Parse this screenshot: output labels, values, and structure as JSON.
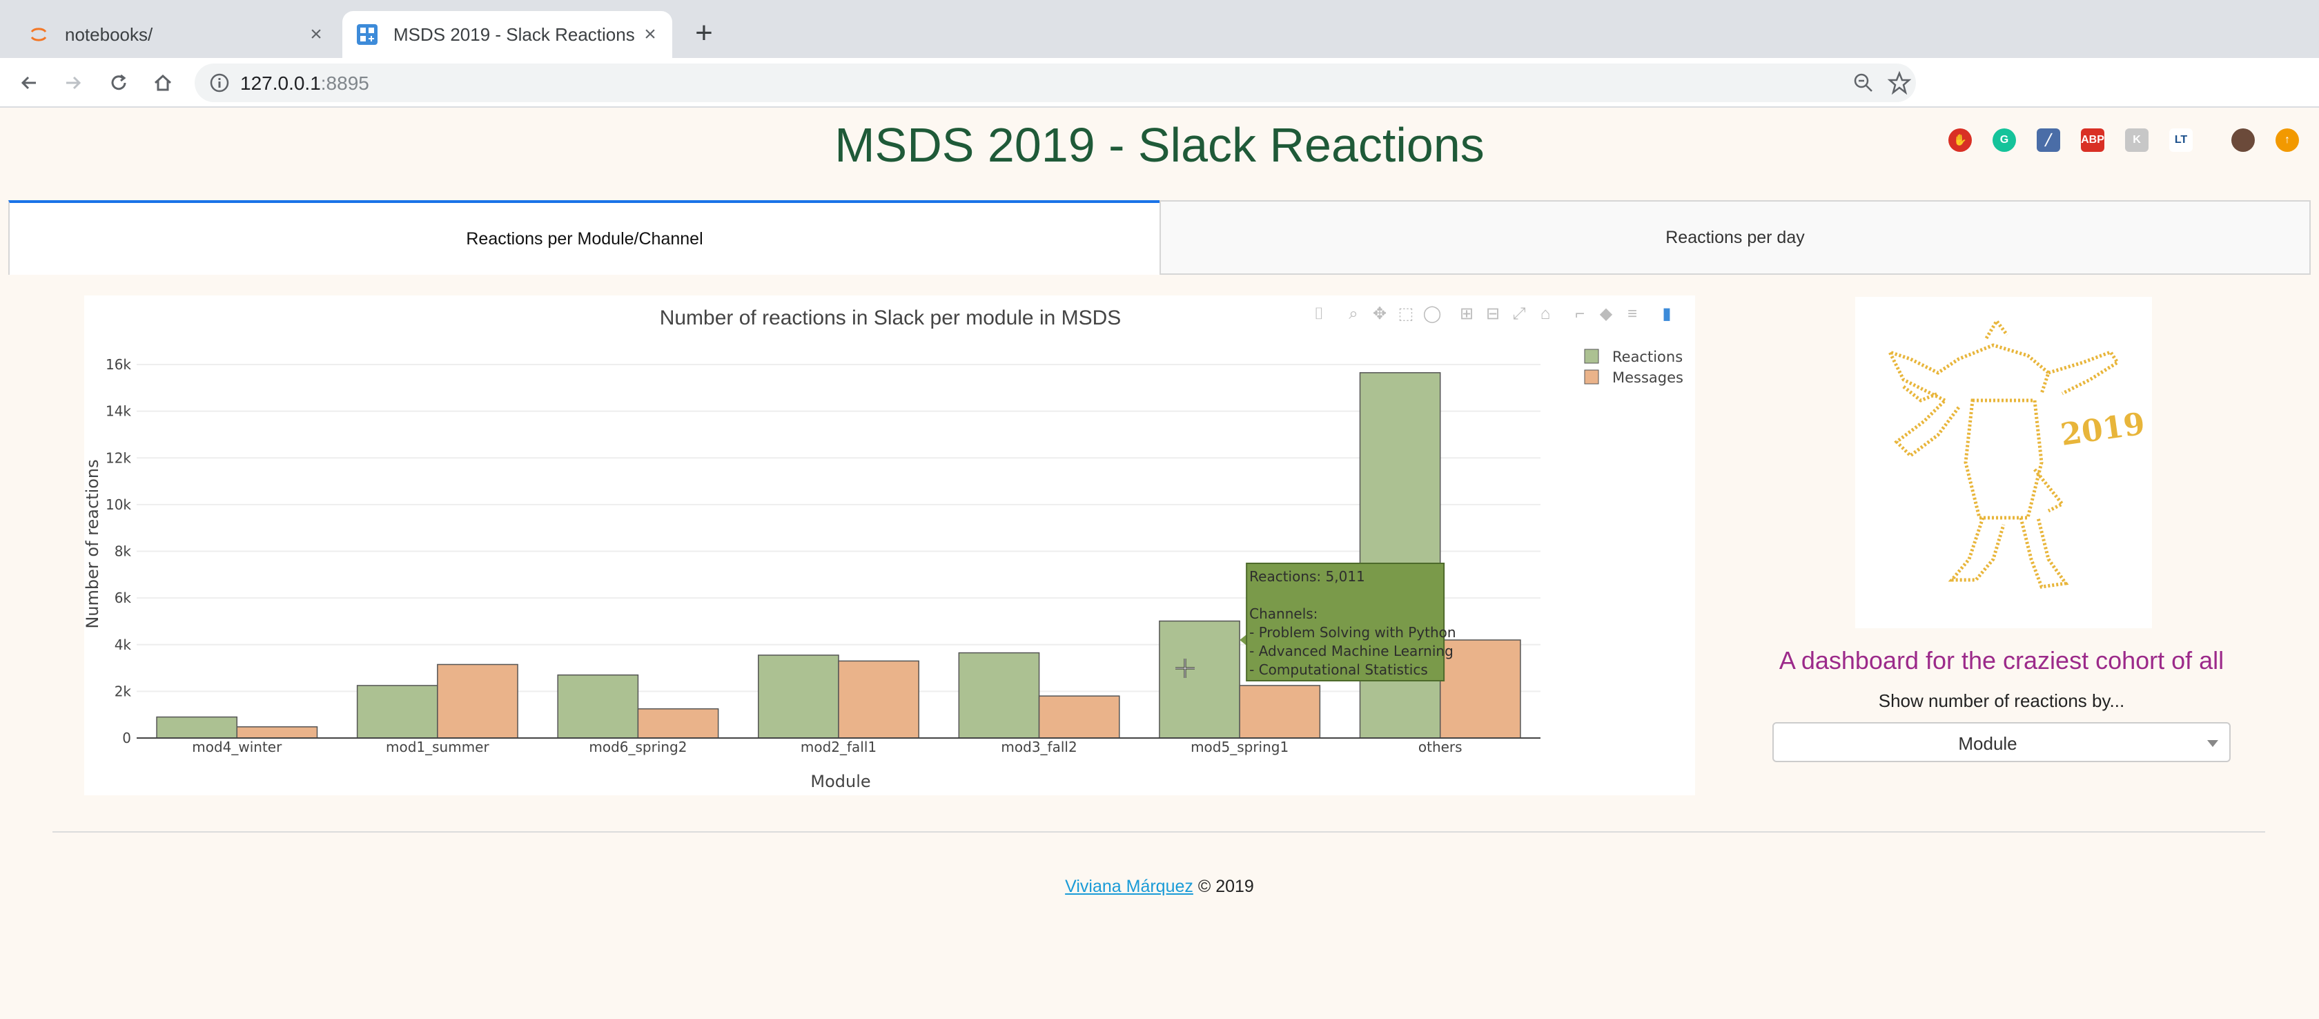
{
  "browser": {
    "tabs": [
      {
        "title": "notebooks/",
        "active": false
      },
      {
        "title": "MSDS 2019 - Slack Reactions",
        "active": true
      }
    ],
    "url_host": "127.0.0.1",
    "url_port": ":8895"
  },
  "page": {
    "title": "MSDS 2019 - Slack Reactions",
    "tabs": [
      "Reactions per Module/Channel",
      "Reactions per day"
    ],
    "tagline": "A dashboard for the craziest cohort of all",
    "dropdown_label": "Show number of reactions by...",
    "dropdown_value": "Module",
    "footer_author": "Viviana Márquez",
    "footer_copy": " © 2019",
    "mascot_text": "2019"
  },
  "chart_data": {
    "type": "bar",
    "title": "Number of reactions in Slack per module in MSDS",
    "xlabel": "Module",
    "ylabel": "Number of reactions",
    "categories": [
      "mod4_winter",
      "mod1_summer",
      "mod6_spring2",
      "mod2_fall1",
      "mod3_fall2",
      "mod5_spring1",
      "others"
    ],
    "series": [
      {
        "name": "Reactions",
        "color": "#acc192",
        "values": [
          900,
          2250,
          2700,
          3550,
          3650,
          5011,
          15650
        ]
      },
      {
        "name": "Messages",
        "color": "#eab38a",
        "values": [
          480,
          3150,
          1250,
          3300,
          1800,
          2250,
          4200
        ]
      }
    ],
    "ylim": [
      0,
      16000
    ],
    "yticks": [
      0,
      2000,
      4000,
      6000,
      8000,
      10000,
      12000,
      14000,
      16000
    ],
    "ytick_labels": [
      "0",
      "2k",
      "4k",
      "6k",
      "8k",
      "10k",
      "12k",
      "14k",
      "16k"
    ],
    "legend_position": "top-right",
    "grid": true,
    "hover": {
      "category": "mod5_spring1",
      "lines": [
        "Reactions: 5,011",
        "",
        "Channels:",
        "- Problem Solving with Python",
        "- Advanced Machine Learning",
        "- Computational Statistics"
      ]
    }
  }
}
